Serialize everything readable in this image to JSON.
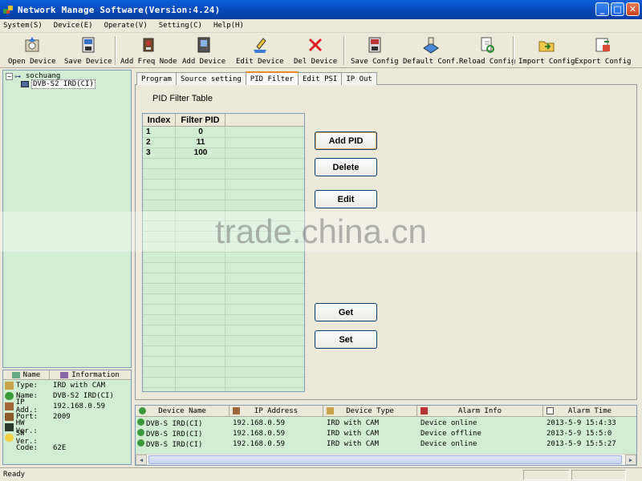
{
  "window": {
    "title": "Network Manage Software(Version:4.24)"
  },
  "menu": [
    "System(S)",
    "Device(E)",
    "Operate(V)",
    "Setting(C)",
    "Help(H)"
  ],
  "toolbar": [
    {
      "label": "Open Device",
      "icon": "open-device-icon"
    },
    {
      "label": "Save Device",
      "icon": "save-device-icon"
    },
    {
      "label": "Add Freq Node",
      "icon": "add-freq-node-icon"
    },
    {
      "label": "Add Device",
      "icon": "add-device-icon"
    },
    {
      "label": "Edit Device",
      "icon": "edit-device-icon"
    },
    {
      "label": "Del Device",
      "icon": "delete-x-icon"
    },
    {
      "label": "Save Config",
      "icon": "save-config-icon"
    },
    {
      "label": "Default Conf.",
      "icon": "default-config-icon"
    },
    {
      "label": "Reload Config",
      "icon": "reload-config-icon"
    },
    {
      "label": "Import Config",
      "icon": "import-config-icon"
    },
    {
      "label": "Export Config",
      "icon": "export-config-icon"
    }
  ],
  "tree": {
    "root": "sochuang",
    "child": "DVB-S2 IRD(CI)"
  },
  "info": {
    "headers": [
      "Name",
      "Information"
    ],
    "rows": [
      {
        "key": "Type:",
        "value": "IRD with CAM"
      },
      {
        "key": "Name:",
        "value": "DVB-S2 IRD(CI)"
      },
      {
        "key": "IP Add.:",
        "value": "192.168.0.59"
      },
      {
        "key": "Port:",
        "value": "2009"
      },
      {
        "key": "HW Ver.:",
        "value": ""
      },
      {
        "key": "SW Ver.:",
        "value": ""
      },
      {
        "key": "Code:",
        "value": "62E"
      }
    ]
  },
  "tabs": [
    "Program",
    "Source setting",
    "PID Filter",
    "Edit PSI",
    "IP Out"
  ],
  "active_tab": "PID Filter",
  "pid_filter": {
    "title": "PID Filter Table",
    "headers": [
      "Index",
      "Filter PID"
    ],
    "rows": [
      {
        "index": "1",
        "pid": "0"
      },
      {
        "index": "2",
        "pid": "11"
      },
      {
        "index": "3",
        "pid": "100"
      }
    ],
    "buttons": {
      "add": "Add PID",
      "delete": "Delete",
      "edit": "Edit",
      "get": "Get",
      "set": "Set"
    }
  },
  "device_list": {
    "headers": [
      "Device Name",
      "IP Address",
      "Device Type",
      "Alarm Info",
      "Alarm Time"
    ],
    "rows": [
      {
        "name": "DVB-S IRD(CI)",
        "ip": "192.168.0.59",
        "type": "IRD with CAM",
        "alarm": "Device online",
        "time": "2013-5-9 15:4:33"
      },
      {
        "name": "DVB-S IRD(CI)",
        "ip": "192.168.0.59",
        "type": "IRD with CAM",
        "alarm": "Device offline",
        "time": "2013-5-9 15:5:0"
      },
      {
        "name": "DVB-S IRD(CI)",
        "ip": "192.168.0.59",
        "type": "IRD with CAM",
        "alarm": "Device online",
        "time": "2013-5-9 15:5:27"
      }
    ]
  },
  "status": {
    "text": "Ready"
  },
  "watermark": "trade.china.cn"
}
